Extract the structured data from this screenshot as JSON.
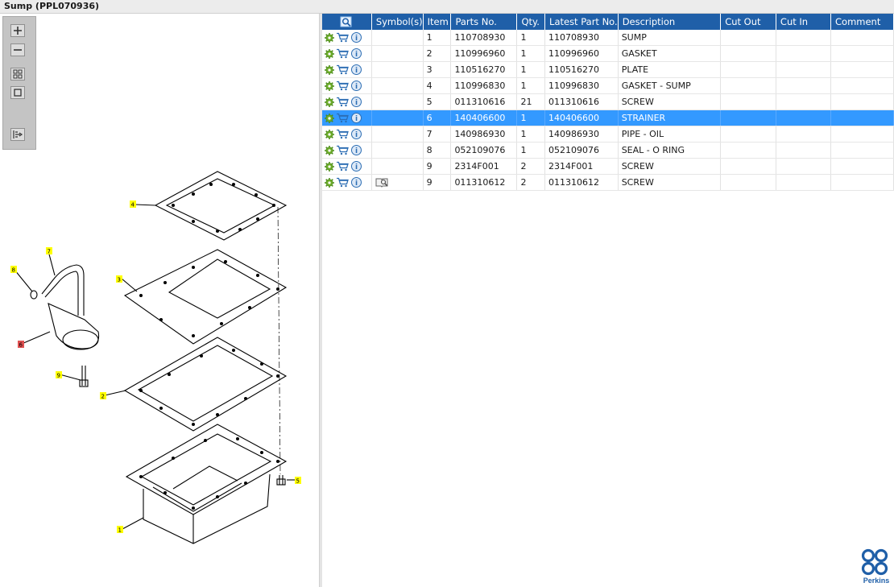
{
  "title": "Sump (PPL070936)",
  "toolbar": {
    "zoom_in": "zoom-in-icon",
    "zoom_out": "zoom-out-icon",
    "fit": "fit-icon",
    "actual": "actual-size-icon",
    "export": "export-icon"
  },
  "diagram": {
    "callouts": [
      "4",
      "7",
      "8",
      "3",
      "6",
      "9",
      "2",
      "5",
      "1"
    ],
    "highlighted_callout": "6"
  },
  "table": {
    "columns": [
      "",
      "Symbol(s)",
      "Item",
      "Parts No.",
      "Qty.",
      "Latest Part No.",
      "Description",
      "Cut Out",
      "Cut In",
      "Comment"
    ],
    "rows": [
      {
        "item": "1",
        "part_no": "110708930",
        "qty": "1",
        "latest": "110708930",
        "desc": "SUMP",
        "symbol": ""
      },
      {
        "item": "2",
        "part_no": "110996960",
        "qty": "1",
        "latest": "110996960",
        "desc": "GASKET",
        "symbol": ""
      },
      {
        "item": "3",
        "part_no": "110516270",
        "qty": "1",
        "latest": "110516270",
        "desc": "PLATE",
        "symbol": ""
      },
      {
        "item": "4",
        "part_no": "110996830",
        "qty": "1",
        "latest": "110996830",
        "desc": "GASKET - SUMP",
        "symbol": ""
      },
      {
        "item": "5",
        "part_no": "011310616",
        "qty": "21",
        "latest": "011310616",
        "desc": "SCREW",
        "symbol": ""
      },
      {
        "item": "6",
        "part_no": "140406600",
        "qty": "1",
        "latest": "140406600",
        "desc": "STRAINER",
        "symbol": "",
        "selected": true
      },
      {
        "item": "7",
        "part_no": "140986930",
        "qty": "1",
        "latest": "140986930",
        "desc": "PIPE - OIL",
        "symbol": ""
      },
      {
        "item": "8",
        "part_no": "052109076",
        "qty": "1",
        "latest": "052109076",
        "desc": "SEAL - O RING",
        "symbol": ""
      },
      {
        "item": "9",
        "part_no": "2314F001",
        "qty": "2",
        "latest": "2314F001",
        "desc": "SCREW",
        "symbol": ""
      },
      {
        "item": "9",
        "part_no": "011310612",
        "qty": "2",
        "latest": "011310612",
        "desc": "SCREW",
        "symbol": "book-search-icon"
      }
    ]
  },
  "brand": {
    "name": "Perkins",
    "color": "#1f5fa8"
  },
  "colors": {
    "header": "#1f5fa8",
    "selected": "#3399ff",
    "callout": "#ffff00",
    "callout_selected": "#e05050"
  }
}
